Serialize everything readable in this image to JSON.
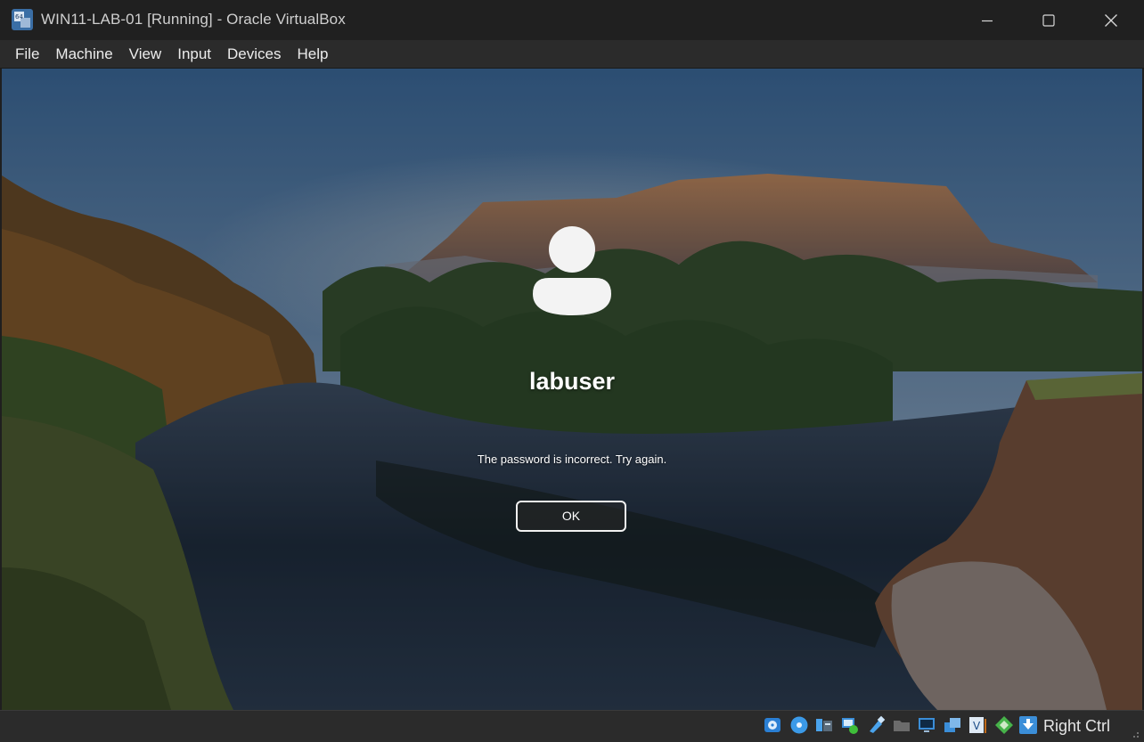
{
  "window": {
    "title": "WIN11-LAB-01 [Running] - Oracle VirtualBox",
    "app_icon": "virtualbox-icon",
    "controls": [
      "minimize-icon",
      "maximize-icon",
      "close-icon"
    ]
  },
  "menubar": {
    "items": [
      "File",
      "Machine",
      "View",
      "Input",
      "Devices",
      "Help"
    ]
  },
  "login": {
    "avatar_icon": "user-avatar-icon",
    "username": "labuser",
    "message": "The password is incorrect. Try again.",
    "ok_label": "OK"
  },
  "statusbar": {
    "icons": [
      "hard-disk-icon",
      "optical-drive-icon",
      "audio-icon",
      "network-icon",
      "usb-icon",
      "shared-folders-icon",
      "display-icon",
      "recording-icon",
      "virtualization-icon",
      "mouse-integration-icon",
      "keyboard-icon"
    ],
    "host_key": "Right Ctrl"
  },
  "colors": {
    "titlebar_bg": "#202020",
    "menubar_bg": "#2b2b2b",
    "statusbar_bg": "#2b2b2b",
    "text": "#ececec"
  }
}
